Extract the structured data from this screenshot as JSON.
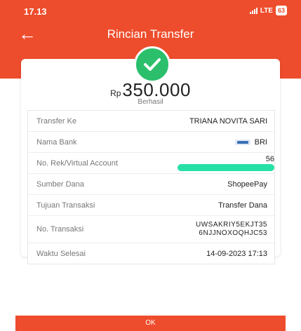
{
  "status_bar": {
    "time": "17.13",
    "network": "LTE",
    "battery": "63"
  },
  "header": {
    "title": "Rincian Transfer"
  },
  "summary": {
    "currency": "Rp",
    "amount": "350.000",
    "status": "Berhasil"
  },
  "details": [
    {
      "label": "Transfer Ke",
      "value": "TRIANA NOVITA SARI"
    },
    {
      "label": "Nama Bank",
      "value": "BRI"
    },
    {
      "label": "No. Rek/Virtual Account",
      "value": "56"
    },
    {
      "label": "Sumber Dana",
      "value": "ShopeePay"
    },
    {
      "label": "Tujuan Transaksi",
      "value": "Transfer Dana"
    },
    {
      "label": "No. Transaksi",
      "value_line1": "UWSAKRIY5EKJT35",
      "value_line2": "6NJJNOXOQHJC53"
    },
    {
      "label": "Waktu Selesai",
      "value": "14-09-2023 17:13"
    }
  ],
  "footer": {
    "ok_label": "OK"
  },
  "colors": {
    "brand": "#ee4d2d",
    "success": "#2bbf6c",
    "redaction": "#26e0a8"
  }
}
